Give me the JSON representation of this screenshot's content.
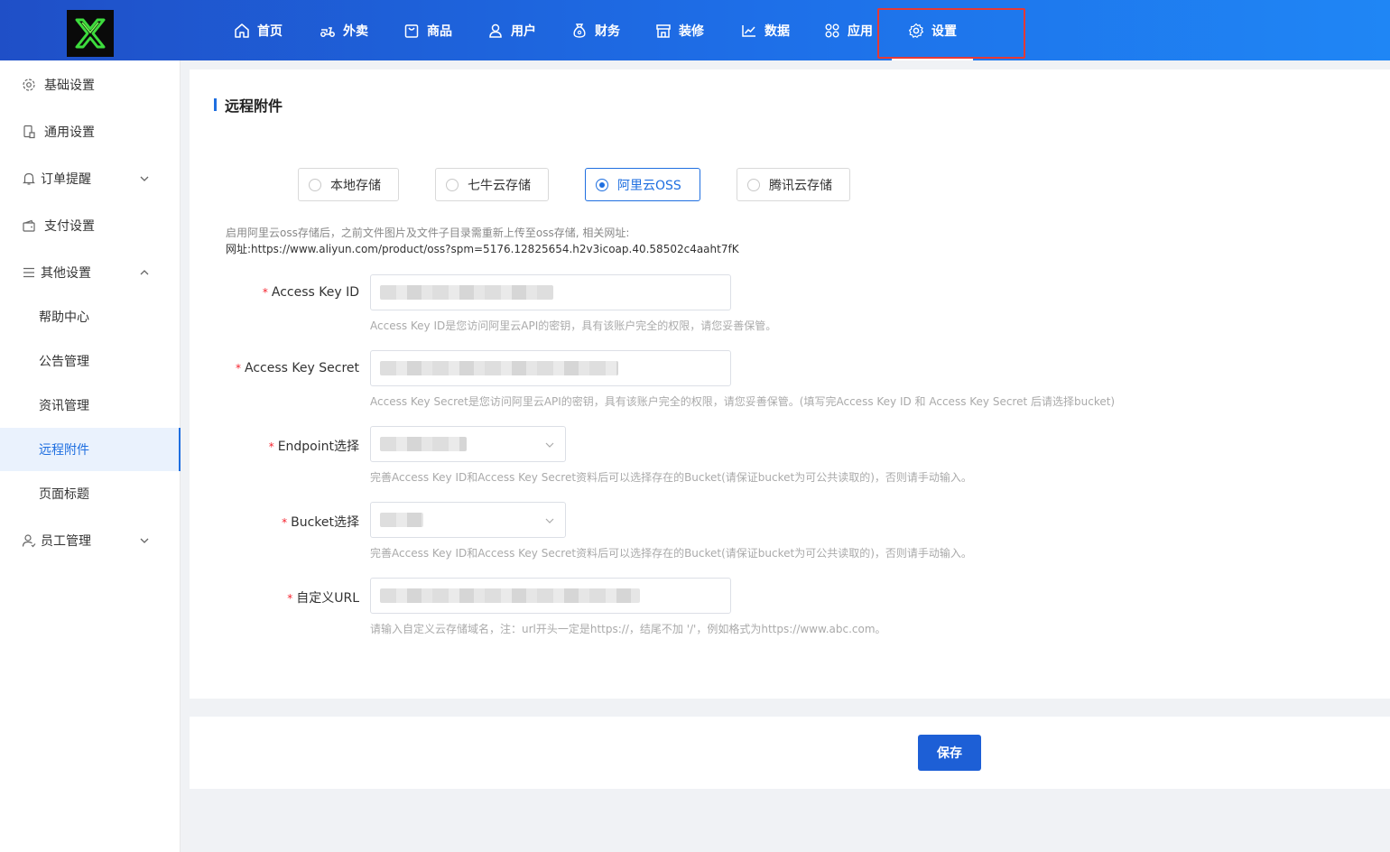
{
  "header": {
    "nav": [
      {
        "label": "首页",
        "icon": "home-icon"
      },
      {
        "label": "外卖",
        "icon": "scooter-icon"
      },
      {
        "label": "商品",
        "icon": "bag-icon"
      },
      {
        "label": "用户",
        "icon": "user-icon"
      },
      {
        "label": "财务",
        "icon": "money-bag-icon"
      },
      {
        "label": "装修",
        "icon": "storefront-icon"
      },
      {
        "label": "数据",
        "icon": "line-chart-icon"
      },
      {
        "label": "应用",
        "icon": "apps-grid-icon"
      },
      {
        "label": "设置",
        "icon": "gear-icon",
        "active": true
      }
    ]
  },
  "sidebar": {
    "items": [
      {
        "label": "基础设置",
        "icon": "gear-icon"
      },
      {
        "label": "通用设置",
        "icon": "phone-icon"
      },
      {
        "label": "订单提醒",
        "icon": "bell-icon",
        "expandable": true
      },
      {
        "label": "支付设置",
        "icon": "wallet-icon"
      },
      {
        "label": "其他设置",
        "icon": "list-icon",
        "expanded": true
      },
      {
        "label": "员工管理",
        "icon": "user-icon",
        "expandable": true
      }
    ],
    "subitems": [
      {
        "label": "帮助中心"
      },
      {
        "label": "公告管理"
      },
      {
        "label": "资讯管理"
      },
      {
        "label": "远程附件",
        "active": true
      },
      {
        "label": "页面标题"
      }
    ]
  },
  "main": {
    "title": "远程附件",
    "storage_options": [
      {
        "label": "本地存储",
        "checked": false
      },
      {
        "label": "七牛云存储",
        "checked": false
      },
      {
        "label": "阿里云OSS",
        "checked": true
      },
      {
        "label": "腾讯云存储",
        "checked": false
      }
    ],
    "notice_line1": "启用阿里云oss存储后，之前文件图片及文件子目录需重新上传至oss存储, 相关网址:",
    "notice_line2": "网址:https://www.aliyun.com/product/oss?spm=5176.12825654.h2v3icoap.40.58502c4aaht7fK",
    "fields": {
      "access_key_id": {
        "label": "Access Key ID",
        "help": "Access Key ID是您访问阿里云API的密钥，具有该账户完全的权限，请您妥善保管。"
      },
      "access_key_secret": {
        "label": "Access Key Secret",
        "help": "Access Key Secret是您访问阿里云API的密钥，具有该账户完全的权限，请您妥善保管。(填写完Access Key ID 和 Access Key Secret 后请选择bucket)"
      },
      "endpoint": {
        "label": "Endpoint选择",
        "help": "完善Access Key ID和Access Key Secret资料后可以选择存在的Bucket(请保证bucket为可公共读取的)，否则请手动输入。"
      },
      "bucket": {
        "label": "Bucket选择",
        "help": "完善Access Key ID和Access Key Secret资料后可以选择存在的Bucket(请保证bucket为可公共读取的)，否则请手动输入。"
      },
      "custom_url": {
        "label": "自定义URL",
        "help": "请输入自定义云存储域名，注：url开头一定是https://，结尾不加 '/'，例如格式为https://www.abc.com。"
      }
    },
    "save_label": "保存"
  },
  "colors": {
    "primary": "#1f6fe0",
    "header_start": "#1f4fc7",
    "header_end": "#1f86f5",
    "logo_green": "#3ddc3d",
    "highlight_red": "#e53935",
    "required_red": "#f5222d"
  }
}
